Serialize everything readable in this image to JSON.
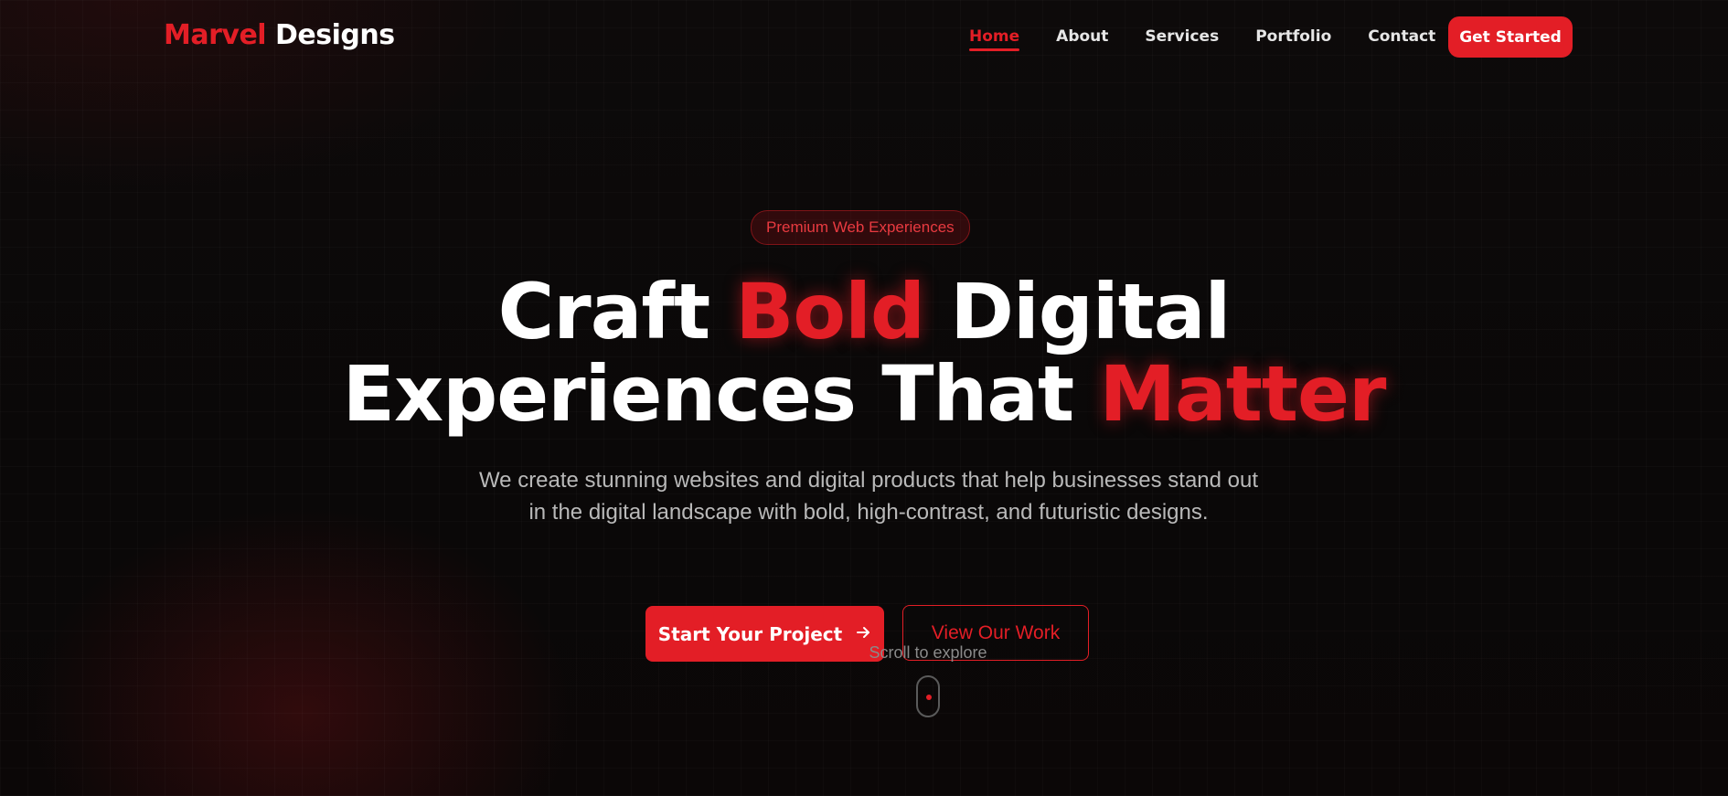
{
  "brand": {
    "part1": "Marvel",
    "part2": "Designs"
  },
  "nav": {
    "items": [
      "Home",
      "About",
      "Services",
      "Portfolio",
      "Contact"
    ],
    "active": "Home",
    "cta": "Get Started"
  },
  "hero": {
    "badge": "Premium Web Experiences",
    "headline": {
      "w1": "Craft",
      "w2": "Bold",
      "w3": "Digital",
      "w4": "Experiences That",
      "w5": "Matter"
    },
    "subtitle": "We create stunning websites and digital products that help businesses stand out in the digital landscape with bold, high-contrast, and futuristic designs.",
    "primary_button": "Start Your Project",
    "primary_icon": "arrow-right-icon",
    "secondary_button": "View Our Work",
    "scroll_text": "Scroll to explore"
  },
  "colors": {
    "accent": "#e31e26",
    "background": "#0b0909",
    "text": "#ffffff",
    "muted": "#b9b9b9"
  }
}
